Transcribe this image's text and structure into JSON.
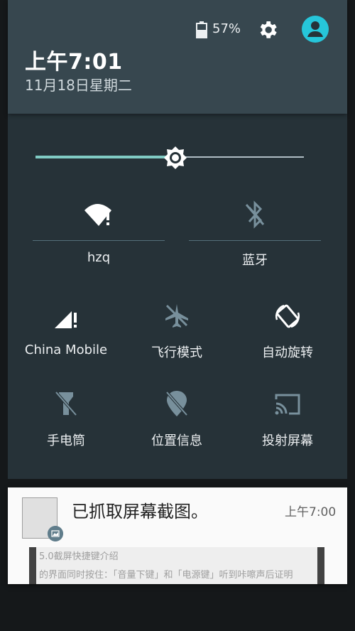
{
  "status": {
    "battery_pct": "57%",
    "battery_level": 0.57
  },
  "header": {
    "time": "上午7:01",
    "date": "11月18日星期二"
  },
  "brightness": {
    "level": 0.52
  },
  "tiles": {
    "wifi": {
      "label": "hzq",
      "icon": "wifi-alert-icon"
    },
    "bluetooth": {
      "label": "蓝牙",
      "icon": "bluetooth-off-icon"
    },
    "cell": {
      "label": "China Mobile",
      "icon": "signal-alert-icon"
    },
    "airplane": {
      "label": "飞行模式",
      "icon": "airplane-icon"
    },
    "rotate": {
      "label": "自动旋转",
      "icon": "rotate-icon"
    },
    "flashlight": {
      "label": "手电筒",
      "icon": "flashlight-off-icon"
    },
    "location": {
      "label": "位置信息",
      "icon": "location-off-icon"
    },
    "cast": {
      "label": "投射屏幕",
      "icon": "cast-icon"
    }
  },
  "notification": {
    "title": "已抓取屏幕截图。",
    "time": "上午7:00",
    "preview_line1": "5.0截屏快捷键介绍",
    "preview_line2": "的界面同时按住：「音量下键」和「电源键」听到咔嚓声后证明"
  },
  "colors": {
    "accent": "#80cbc4",
    "avatar": "#26c6da",
    "panel": "#263238",
    "header": "#37474f"
  }
}
